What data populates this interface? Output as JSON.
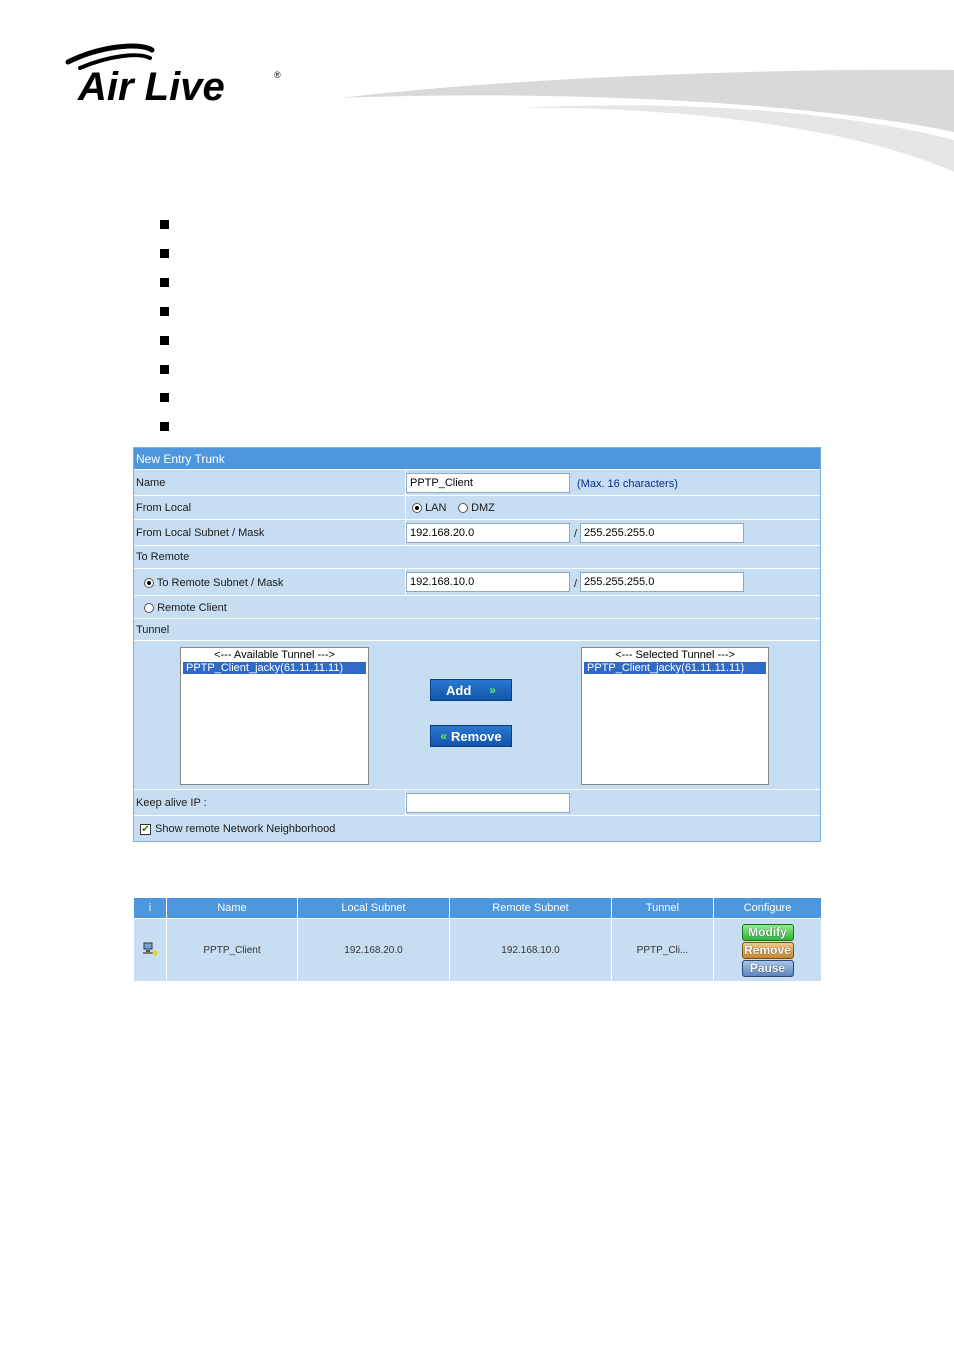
{
  "brand": {
    "logo_text": "Air Live",
    "registered_mark": "®"
  },
  "bullets_count": 8,
  "form": {
    "title": "New Entry Trunk",
    "name_label": "Name",
    "name_value": "PPTP_Client",
    "name_hint": "(Max. 16 characters)",
    "from_local_label": "From Local",
    "from_local_options": [
      {
        "label": "LAN",
        "checked": true
      },
      {
        "label": "DMZ",
        "checked": false
      }
    ],
    "from_local_subnet_label": "From Local Subnet / Mask",
    "from_local_subnet": "192.168.20.0",
    "from_local_mask": "255.255.255.0",
    "slash": "/",
    "to_remote_label": "To Remote",
    "to_remote_subnet_label": "To Remote Subnet / Mask",
    "to_remote_subnet": "192.168.10.0",
    "to_remote_mask": "255.255.255.0",
    "remote_client_label": "Remote Client",
    "tunnel_label": "Tunnel",
    "available_header": "<--- Available Tunnel --->",
    "available_item": "PPTP_Client_jacky(61.11.11.11)",
    "selected_header": "<--- Selected Tunnel --->",
    "selected_item": "PPTP_Client_jacky(61.11.11.11)",
    "add_label": "Add",
    "remove_label": "Remove",
    "keep_alive_label": "Keep alive IP :",
    "keep_alive_value": "",
    "show_neighborhood_label": "Show remote Network Neighborhood",
    "show_neighborhood_checked": true
  },
  "table": {
    "headers": [
      "i",
      "Name",
      "Local Subnet",
      "Remote Subnet",
      "Tunnel",
      "Configure"
    ],
    "row": {
      "name": "PPTP_Client",
      "local_subnet": "192.168.20.0",
      "remote_subnet": "192.168.10.0",
      "tunnel": "PPTP_Cli..."
    },
    "buttons": {
      "modify": "Modify",
      "remove": "Remove",
      "pause": "Pause"
    }
  },
  "colors": {
    "panel_bg": "#c7def2",
    "header_bg": "#4c97dd",
    "button_blue": "#1a66be",
    "hint_text": "#0a2a8c"
  }
}
